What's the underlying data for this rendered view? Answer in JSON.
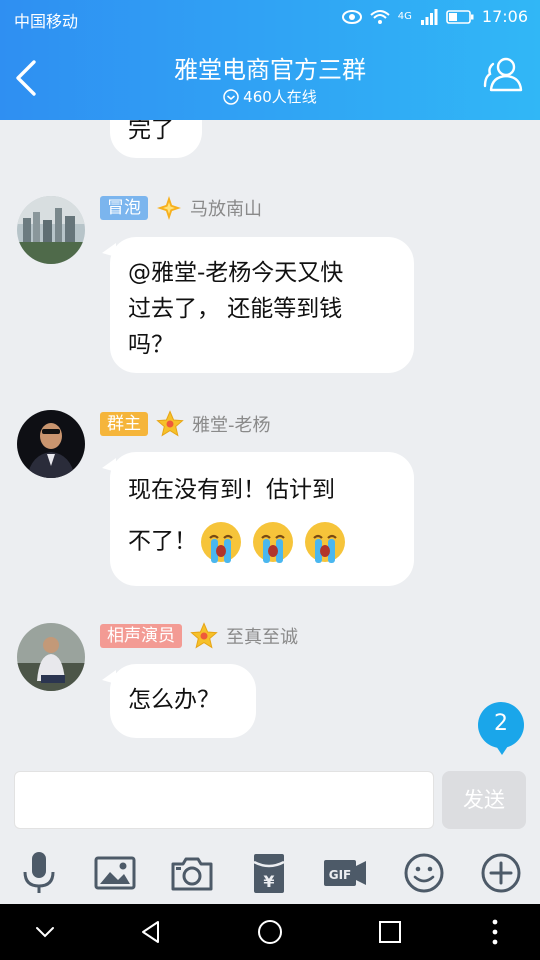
{
  "status": {
    "carrier": "中国移动",
    "net": "4G",
    "time": "17:06"
  },
  "header": {
    "title": "雅堂电商官方三群",
    "online": "460人在线"
  },
  "messages": [
    {
      "partial_text": "完了"
    },
    {
      "badge": "冒泡",
      "badge_color": "#7bb5ee",
      "star": "orange-sparkle",
      "name": "马放南山",
      "lines": [
        "@雅堂-老杨今天又快",
        "过去了， 还能等到钱",
        "吗？"
      ]
    },
    {
      "badge": "群主",
      "badge_color": "#f5b53b",
      "star": "gold-star",
      "name": "雅堂-老杨",
      "line1": "现在没有到！估计到",
      "line2": "不了！"
    },
    {
      "badge": "相声演员",
      "badge_color": "#f39b94",
      "star": "gold-star",
      "name": "至真至诚",
      "text": "怎么办？"
    }
  ],
  "unread_count": "2",
  "input": {
    "placeholder": "",
    "send_label": "发送"
  },
  "toolbar": [
    "mic-icon",
    "image-icon",
    "camera-icon",
    "red-packet-icon",
    "gif-icon",
    "emoji-icon",
    "plus-icon"
  ],
  "colors": {
    "header_from": "#2f8ff2",
    "header_to": "#31b7f6",
    "unread": "#1aa6ea"
  }
}
